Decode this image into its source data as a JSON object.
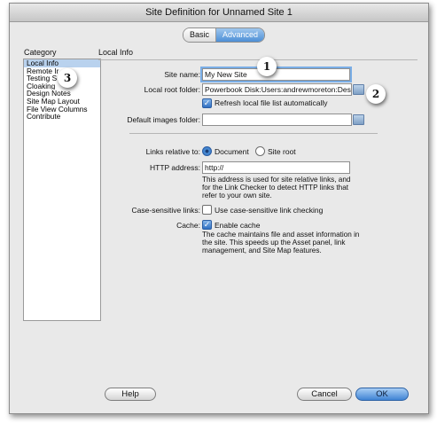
{
  "window": {
    "title": "Site Definition for Unnamed Site 1"
  },
  "tabs": {
    "basic": "Basic",
    "advanced": "Advanced"
  },
  "category": {
    "header": "Category",
    "items": [
      "Local Info",
      "Remote Ir",
      "Testing S",
      "Cloaking",
      "Design Notes",
      "Site Map Layout",
      "File View Columns",
      "Contribute"
    ]
  },
  "local_info": {
    "section_title": "Local Info",
    "site_name_label": "Site name:",
    "site_name_value": "My New Site",
    "local_root_label": "Local root folder:",
    "local_root_value": "Powerbook Disk:Users:andrewmoreton:Deskto",
    "refresh_label": "Refresh local file list automatically",
    "default_images_label": "Default images folder:",
    "default_images_value": "",
    "links_relative_label": "Links relative to:",
    "links_option_document": "Document",
    "links_option_site_root": "Site root",
    "http_label": "HTTP address:",
    "http_value": "http://",
    "http_note_lines": [
      "This address is used for site relative links, and",
      "for the Link Checker to detect HTTP links that",
      "refer to your own site."
    ],
    "case_label": "Case-sensitive links:",
    "case_checkbox_label": "Use case-sensitive link checking",
    "cache_label": "Cache:",
    "cache_checkbox_label": "Enable cache",
    "cache_note_lines": [
      "The cache maintains file and asset information in",
      "the site.  This speeds up the Asset panel, link",
      "management, and Site Map features."
    ]
  },
  "buttons": {
    "help": "Help",
    "cancel": "Cancel",
    "ok": "OK"
  },
  "callouts": [
    "1",
    "2",
    "3"
  ],
  "colors": {
    "accent": "#3f83d4",
    "selection": "#b9d2ee"
  }
}
